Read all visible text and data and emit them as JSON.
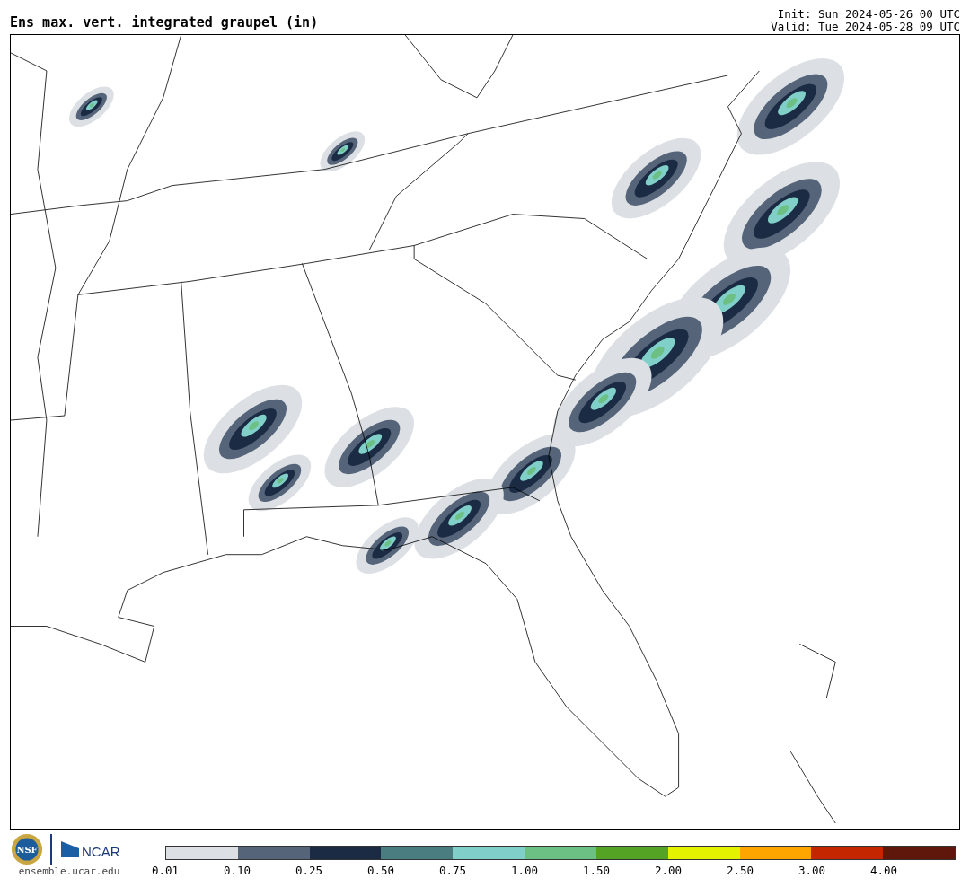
{
  "title": "Ens max. vert. integrated graupel (in)",
  "init": "Init: Sun 2024-05-26 00 UTC",
  "valid": "Valid: Tue 2024-05-28 09 UTC",
  "logos": {
    "nsf": "NSF",
    "ncar": "NCAR",
    "site": "ensemble.ucar.edu"
  },
  "colorbar": {
    "bins": [
      {
        "color": "#dce0e4"
      },
      {
        "color": "#556479"
      },
      {
        "color": "#1b2b44"
      },
      {
        "color": "#4a7d80"
      },
      {
        "color": "#80cfc8"
      },
      {
        "color": "#6cc083"
      },
      {
        "color": "#54a324"
      },
      {
        "color": "#e4f200"
      },
      {
        "color": "#ffa500"
      },
      {
        "color": "#c42600"
      },
      {
        "color": "#60170b"
      }
    ],
    "ticks": [
      "0.01",
      "0.10",
      "0.25",
      "0.50",
      "0.75",
      "1.00",
      "1.50",
      "2.00",
      "2.50",
      "3.00",
      "4.00"
    ]
  }
}
